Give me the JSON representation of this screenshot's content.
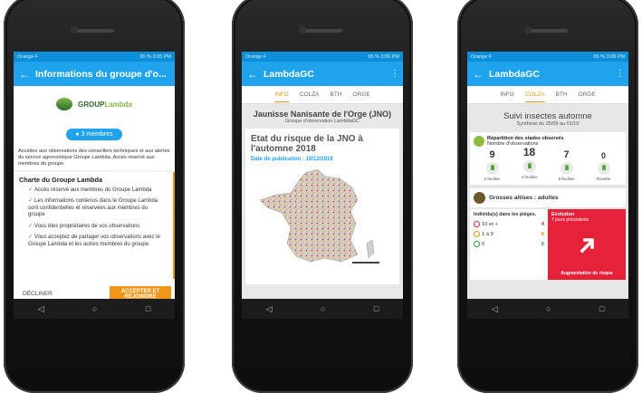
{
  "phones": [
    {
      "status": {
        "left": "Orange F",
        "right": "65 % 3:05 PM"
      },
      "title": "Informations du groupe d'o...",
      "brand": {
        "a": "GROUP",
        "b": "Lambda"
      },
      "members_label": "3 membres",
      "description": "Accédez aux observations des conseillers techniques et aux alertes du service agronomique Groupe Lambda. Accès réservé aux membres du groupe.",
      "charte_title": "Charte du Groupe Lambda",
      "charte_items": [
        "Accès réservé aux membres du Groupe Lambda",
        "Les informations contenus dans le Groupe Lambda sont confidentielles et réservées aux membres du groupe",
        "Vous êtes propriétaires de vos observations",
        "Vous acceptez de partager vos observations avec le Groupe Lambda et les autres membres du groupe"
      ],
      "decline": "DÉCLINER",
      "accept": "ACCEPTER ET REJOINDRE"
    },
    {
      "status": {
        "left": "Orange F",
        "right": "65 % 3:06 PM"
      },
      "title": "LambdaGC",
      "tabs": [
        "INFO",
        "COLZA",
        "BTH",
        "ORGE"
      ],
      "active_tab": "INFO",
      "heading": "Jaunisse Nanisante de l'Orge (JNO)",
      "subheading": "Groupe d'observation LambdaGC",
      "card_title": "Etat du risque de la JNO à l'automne 2018",
      "pub_date": "Date de publication : 19/12/2018"
    },
    {
      "status": {
        "left": "Orange F",
        "right": "65 % 3:08 PM"
      },
      "title": "LambdaGC",
      "tabs": [
        "INFO",
        "COLZA",
        "BTH",
        "ORGE"
      ],
      "active_tab": "COLZA",
      "heading": "Suivi insectes automne",
      "subheading": "Synthèse du 25/09 au 01/10",
      "rep_title": "Répartition des stades observés",
      "rep_sub": "Nombre d'observations",
      "stages": [
        {
          "n": "9",
          "label": "2 feuilles"
        },
        {
          "n": "18",
          "label": "4 feuilles"
        },
        {
          "n": "7",
          "label": "6 feuilles"
        },
        {
          "n": "0",
          "label": "Rosette"
        }
      ],
      "altise_title": "Grosses altises : adultes",
      "pieges_title": "Individu(s) dans les pièges.",
      "counts": [
        {
          "label": "10 et +",
          "value": "4",
          "color": "#e8213b"
        },
        {
          "label": "1 à 9",
          "value": "8",
          "color": "#f0961b"
        },
        {
          "label": "0",
          "value": "0",
          "color": "#2a9a3a"
        }
      ],
      "evolution_title": "Evolution",
      "evolution_sub": "7 jours précédents",
      "evolution_text": "Augmentation du risque"
    }
  ]
}
